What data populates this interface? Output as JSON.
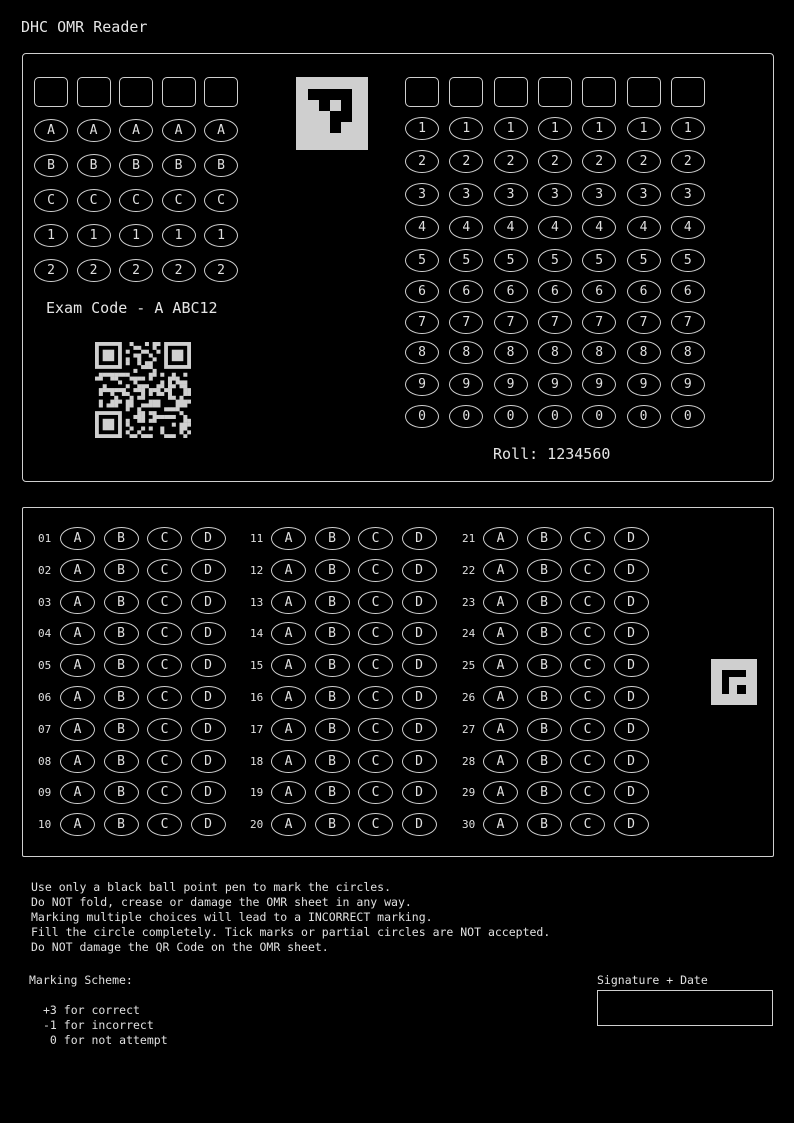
{
  "app": {
    "title": "DHC OMR Reader"
  },
  "exam_code": {
    "label": "Exam Code - A ABC12",
    "columns": 5,
    "rows": [
      "A",
      "B",
      "C",
      "1",
      "2"
    ]
  },
  "roll": {
    "label": "Roll: 1234560",
    "columns": 7,
    "digits": [
      "1",
      "2",
      "3",
      "4",
      "5",
      "6",
      "7",
      "8",
      "9",
      "0"
    ]
  },
  "answers": {
    "options": [
      "A",
      "B",
      "C",
      "D"
    ],
    "question_numbers": [
      "01",
      "02",
      "03",
      "04",
      "05",
      "06",
      "07",
      "08",
      "09",
      "10",
      "11",
      "12",
      "13",
      "14",
      "15",
      "16",
      "17",
      "18",
      "19",
      "20",
      "21",
      "22",
      "23",
      "24",
      "25",
      "26",
      "27",
      "28",
      "29",
      "30"
    ]
  },
  "instructions": [
    "Use only a black ball point pen to mark the circles.",
    "Do NOT fold, crease or damage the OMR sheet in any way.",
    "Marking multiple choices will lead to a INCORRECT marking.",
    "Fill the circle completely. Tick marks or partial circles are NOT accepted.",
    "Do NOT damage the QR Code on the OMR sheet."
  ],
  "marking_scheme": {
    "title": "Marking Scheme:",
    "lines": [
      "+3 for correct",
      "-1 for incorrect",
      " 0 for not attempt"
    ]
  },
  "signature": {
    "label": "Signature + Date",
    "value": ""
  },
  "colors": {
    "background": "#000000",
    "ink": "#dcdcdc",
    "marker_fill": "#cfcfcf"
  },
  "icons": [
    "fiducial-marker-icon",
    "qr-code-icon",
    "small-fiducial-marker-icon"
  ]
}
